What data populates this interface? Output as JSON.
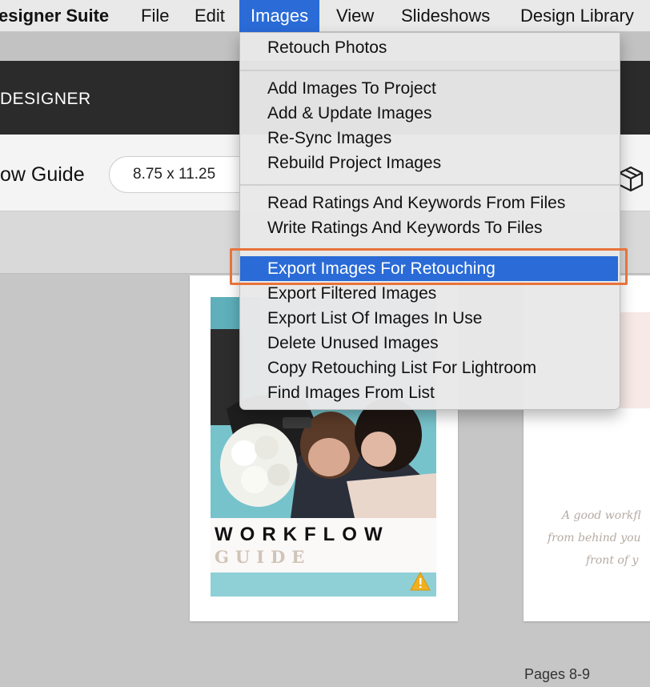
{
  "menubar": {
    "app": "esigner Suite",
    "items": [
      "File",
      "Edit",
      "Images",
      "View",
      "Slideshows",
      "Design Library"
    ],
    "active": "Images"
  },
  "app": {
    "title": "DESIGNER"
  },
  "toolbar": {
    "project_name": "ow Guide",
    "size": "8.75 x 11.25"
  },
  "images_menu": {
    "groups": [
      [
        "Retouch Photos"
      ],
      [
        "Add Images To Project",
        "Add & Update Images",
        "Re-Sync Images",
        "Rebuild Project Images"
      ],
      [
        "Read Ratings And Keywords From Files",
        "Write Ratings And Keywords To Files"
      ],
      [
        "Export Images For Retouching",
        "Export Filtered Images",
        "Export List Of Images In Use",
        "Delete Unused Images",
        "Copy Retouching List For Lightroom",
        "Find Images From List"
      ]
    ],
    "selected": "Export Images For Retouching"
  },
  "cover": {
    "title": "WORKFLOW",
    "subtitle": "GUIDE"
  },
  "right_page": {
    "quote_lines": [
      "A good workfl",
      "from behind you",
      "front of y"
    ]
  },
  "status": {
    "pages": "Pages 8-9"
  },
  "colors": {
    "menu_highlight": "#2a6bd7",
    "callout": "#e8733a",
    "app_bar": "#2b2b2b",
    "warning": "#f2b01e"
  }
}
